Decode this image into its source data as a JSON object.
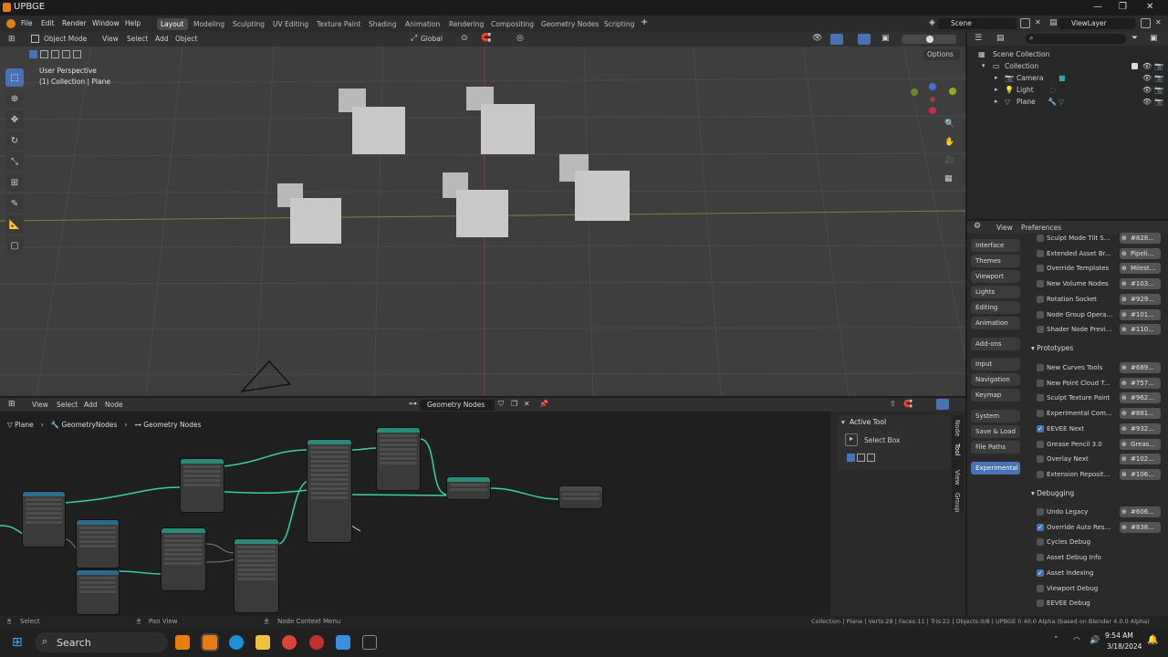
{
  "app": {
    "title": "UPBGE"
  },
  "menu": [
    "File",
    "Edit",
    "Render",
    "Window",
    "Help"
  ],
  "workspaces": [
    "Layout",
    "Modeling",
    "Sculpting",
    "UV Editing",
    "Texture Paint",
    "Shading",
    "Animation",
    "Rendering",
    "Compositing",
    "Geometry Nodes",
    "Scripting"
  ],
  "active_workspace": "Layout",
  "scene": "Scene",
  "view_layer": "ViewLayer",
  "viewport": {
    "mode": "Object Mode",
    "menus": [
      "View",
      "Select",
      "Add",
      "Object"
    ],
    "transform": "Global",
    "options": "Options",
    "overlay_title": "User Perspective",
    "overlay_sub": "(1) Collection | Plane"
  },
  "outliner": {
    "root": "Scene Collection",
    "collection": "Collection",
    "items": [
      "Camera",
      "Light",
      "Plane"
    ]
  },
  "prefs": {
    "menus": [
      "View",
      "Preferences"
    ],
    "categories": [
      "Interface",
      "Themes",
      "Viewport",
      "Lights",
      "Editing",
      "Animation",
      "Add-ons",
      "Input",
      "Navigation",
      "Keymap",
      "System",
      "Save & Load",
      "File Paths",
      "Experimental"
    ],
    "active_category": "Experimental",
    "top_rows": [
      {
        "label": "Sculpt Mode Tilt S...",
        "link": "#828...",
        "checked": false
      },
      {
        "label": "Extended Asset Br...",
        "link": "Pipeli...",
        "checked": false
      },
      {
        "label": "Override Templates",
        "link": "Milest...",
        "checked": false
      },
      {
        "label": "New Volume Nodes",
        "link": "#103...",
        "checked": false
      },
      {
        "label": "Rotation Socket",
        "link": "#929...",
        "checked": false
      },
      {
        "label": "Node Group Opera...",
        "link": "#101...",
        "checked": false
      },
      {
        "label": "Shader Node Previ...",
        "link": "#110...",
        "checked": false
      }
    ],
    "prototypes_title": "Prototypes",
    "prototypes": [
      {
        "label": "New Curves Tools",
        "link": "#689...",
        "checked": false
      },
      {
        "label": "New Point Cloud T...",
        "link": "#757...",
        "checked": false
      },
      {
        "label": "Sculpt Texture Paint",
        "link": "#962...",
        "checked": false
      },
      {
        "label": "Experimental Com...",
        "link": "#881...",
        "checked": false
      },
      {
        "label": "EEVEE Next",
        "link": "#932...",
        "checked": true
      },
      {
        "label": "Grease Pencil 3.0",
        "link": "Greas...",
        "checked": false
      },
      {
        "label": "Overlay Next",
        "link": "#102...",
        "checked": false
      },
      {
        "label": "Extension Reposit...",
        "link": "#106...",
        "checked": false
      }
    ],
    "debugging_title": "Debugging",
    "debugging": [
      {
        "label": "Undo Legacy",
        "link": "#606...",
        "checked": false
      },
      {
        "label": "Override Auto Res...",
        "link": "#838...",
        "checked": true
      },
      {
        "label": "Cycles Debug",
        "link": "",
        "checked": false
      },
      {
        "label": "Asset Debug Info",
        "link": "",
        "checked": false
      },
      {
        "label": "Asset Indexing",
        "link": "",
        "checked": true
      },
      {
        "label": "Viewport Debug",
        "link": "",
        "checked": false
      },
      {
        "label": "EEVEE Debug",
        "link": "",
        "checked": false
      }
    ]
  },
  "node_editor": {
    "menus": [
      "View",
      "Select",
      "Add",
      "Node"
    ],
    "tree": "Geometry Nodes",
    "breadcrumb": [
      "Plane",
      "GeometryNodes",
      "Geometry Nodes"
    ],
    "side_tabs": [
      "Node",
      "Tool",
      "View",
      "Group"
    ],
    "active_tool_title": "Active Tool",
    "active_tool": "Select Box"
  },
  "status": {
    "left": "Select",
    "mid": "Pan View",
    "ctx": "Node Context Menu",
    "right": "Collection | Plane | Verts:28 | Faces:11 | Tris:22 | Objects:0/8 | UPBGE 0.40.0 Alpha (based on Blender 4.0.0 Alpha)"
  },
  "taskbar": {
    "search": "Search",
    "time": "9:54 AM",
    "date": "3/18/2024"
  }
}
